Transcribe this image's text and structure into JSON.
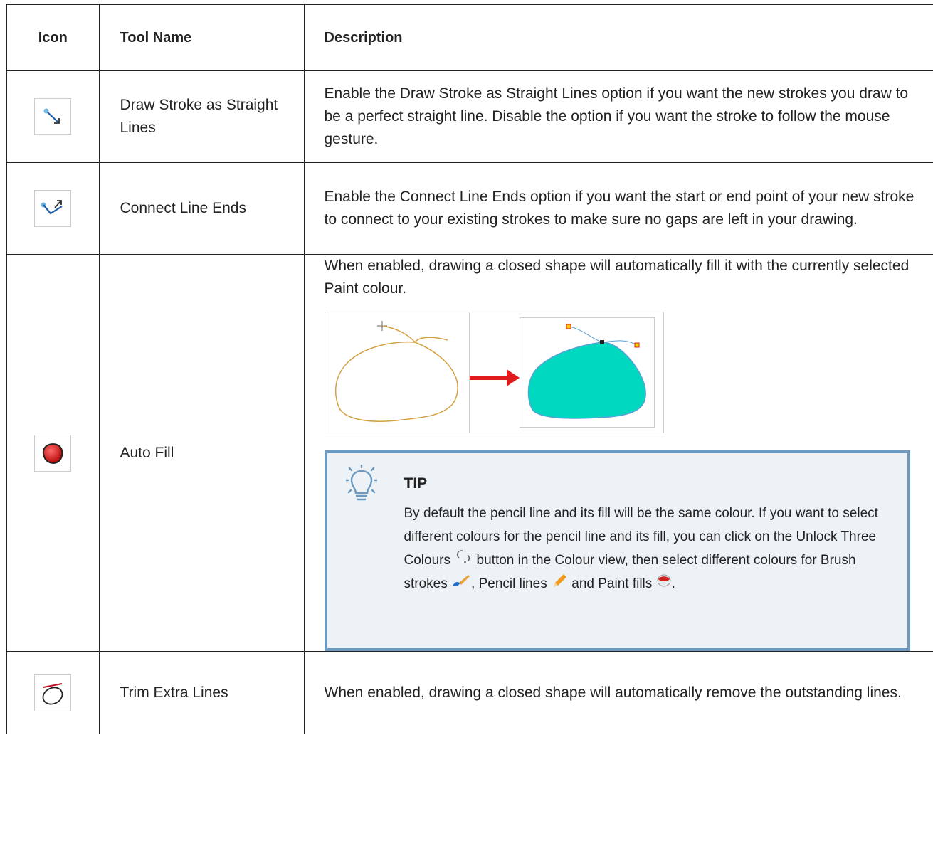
{
  "table": {
    "headers": {
      "icon": "Icon",
      "tool_name": "Tool Name",
      "description": "Description"
    },
    "rows": [
      {
        "icon": "draw-straight-lines-icon",
        "name": "Draw Stroke as Straight Lines",
        "description": "Enable the Draw Stroke as Straight Lines option if you want the new strokes you draw to be a perfect straight line. Disable the option if you want the stroke to follow the mouse gesture."
      },
      {
        "icon": "connect-line-ends-icon",
        "name": "Connect Line Ends",
        "description": "Enable the Connect Line Ends option if you want the start or end point of your new stroke to connect to your existing strokes to make sure no gaps are left in your drawing."
      },
      {
        "icon": "auto-fill-icon",
        "name": "Auto Fill",
        "description": "When enabled, drawing a closed shape will automatically fill it with the currently selected Paint colour.",
        "tip": {
          "title": "TIP",
          "text_1": "By default the pencil line and its fill will be the same colour. If you want to select different colours for the pencil line and its fill, you can click on the Unlock Three Colours",
          "text_2": "button in the Colour view, then select different colours for Brush strokes",
          "text_3": ", Pencil lines",
          "text_4": "and Paint fills",
          "text_5": "."
        }
      },
      {
        "icon": "trim-extra-lines-icon",
        "name": "Trim Extra Lines",
        "description": "When enabled, drawing a closed shape will automatically remove the outstanding lines."
      }
    ]
  },
  "colors": {
    "fill": "#00d9bf",
    "pencil_line": "#d4a040",
    "arrow": "#e11b1b",
    "tip_border": "#6c9ac0",
    "tip_background": "#edf2f7"
  }
}
